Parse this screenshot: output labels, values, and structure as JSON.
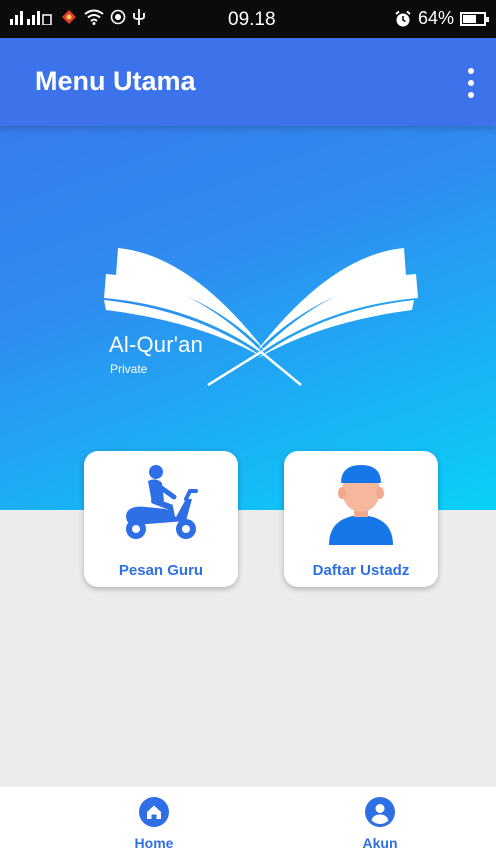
{
  "status_bar": {
    "time": "09.18",
    "battery": "64%",
    "battery_level": 0.64
  },
  "app_bar": {
    "title": "Menu Utama"
  },
  "logo": {
    "title": "Al-Qur'an",
    "subtitle": "Private"
  },
  "cards": [
    {
      "label": "Pesan Guru",
      "icon": "scooter-rider-icon"
    },
    {
      "label": "Daftar Ustadz",
      "icon": "ustadz-avatar-icon"
    }
  ],
  "bottom_nav": {
    "items": [
      {
        "label": "Home",
        "icon": "home-icon",
        "active": true
      },
      {
        "label": "Akun",
        "icon": "account-icon",
        "active": false
      }
    ]
  },
  "colors": {
    "primary": "#3d73ea",
    "accent": "#2f6fe6",
    "gradient_end": "#0ad0f8",
    "background": "#ececef"
  }
}
